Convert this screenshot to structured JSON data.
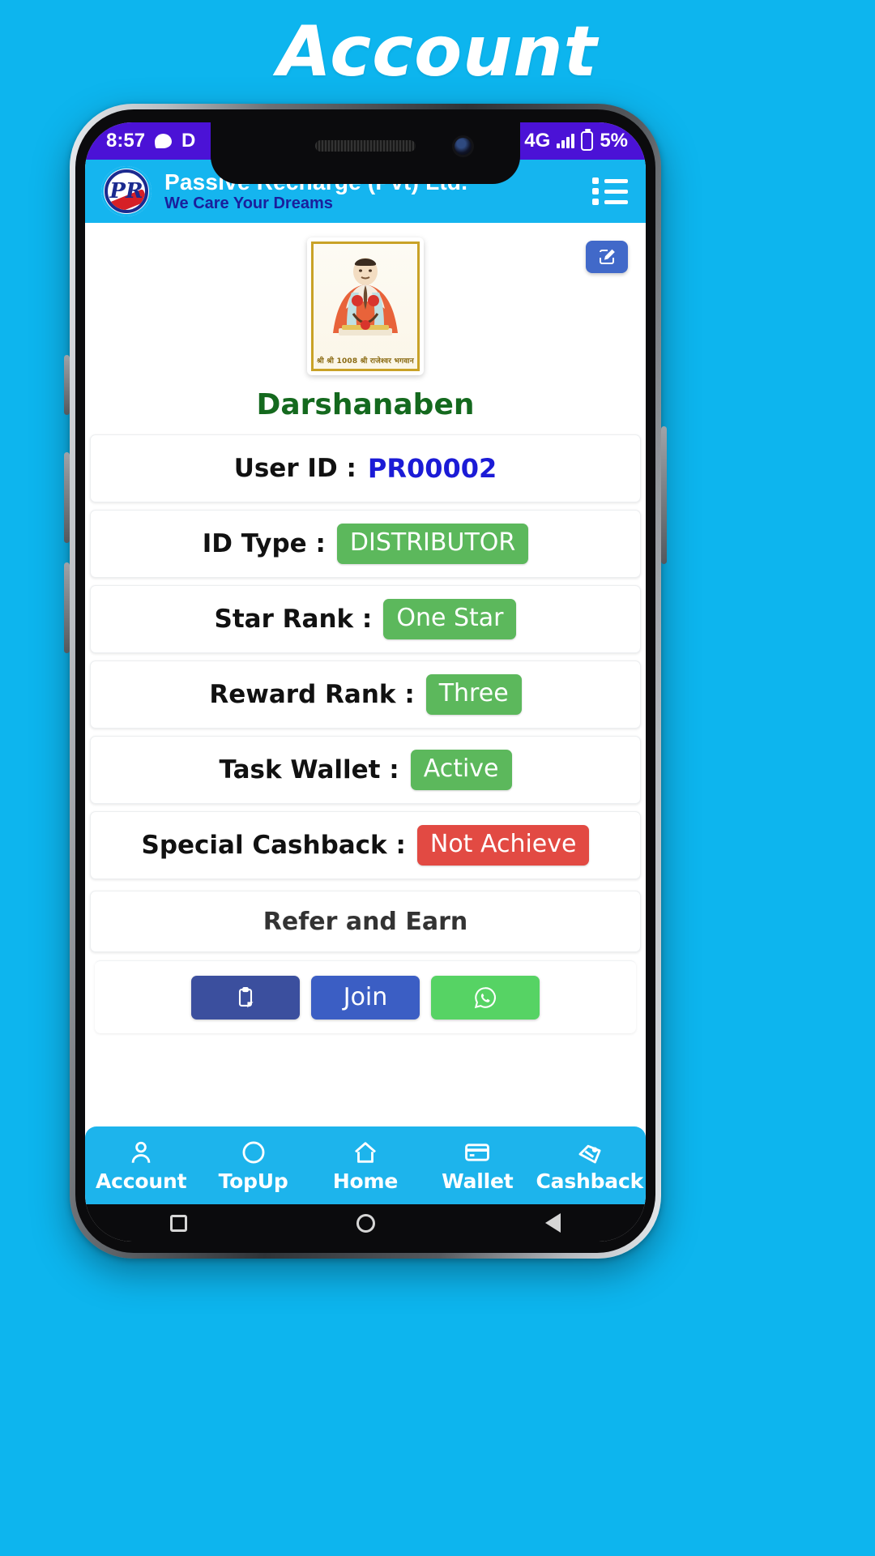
{
  "page": {
    "title": "Account",
    "background_color": "#0db5ee"
  },
  "status_bar": {
    "time": "8:57",
    "chat_icon": "chat-bubble-icon",
    "extra_glyph": "D",
    "network": "4G",
    "signal_icon": "signal-bars-icon",
    "battery_icon": "battery-icon",
    "battery_percent": "5%"
  },
  "app_header": {
    "logo": "passive-recharge-logo",
    "logo_text": "PR",
    "brand_name": "Passive Recharge (Pvt) Ltd.",
    "tagline": "We Care Your Dreams",
    "menu_icon": "list-menu-icon",
    "background_color": "#15b5ef"
  },
  "profile": {
    "edit_icon": "edit-square-icon",
    "avatar_caption": "श्री श्री 1008 श्री राजेश्वर भगवान",
    "name": "Darshanaben",
    "name_color": "#14691e"
  },
  "details": [
    {
      "label": "User ID :",
      "value": "PR00002",
      "style": "plain",
      "color": "#1b1bd6"
    },
    {
      "label": "ID Type :",
      "value": "DISTRIBUTOR",
      "style": "badge",
      "color": "#5cb85c"
    },
    {
      "label": "Star Rank :",
      "value": "One Star",
      "style": "badge",
      "color": "#5cb85c"
    },
    {
      "label": "Reward Rank :",
      "value": "Three",
      "style": "badge",
      "color": "#5cb85c"
    },
    {
      "label": "Task Wallet :",
      "value": "Active",
      "style": "badge",
      "color": "#5cb85c"
    },
    {
      "label": "Special Cashback :",
      "value": "Not Achieve",
      "style": "badge",
      "color": "#e24a43"
    }
  ],
  "refer": {
    "title": "Refer and Earn",
    "buttons": [
      {
        "name": "copy-button",
        "label": "",
        "icon": "clipboard-icon",
        "color": "#3b4f9e"
      },
      {
        "name": "join-button",
        "label": "Join",
        "icon": "",
        "color": "#3b5ec4"
      },
      {
        "name": "whatsapp-button",
        "label": "",
        "icon": "whatsapp-icon",
        "color": "#56d364"
      }
    ]
  },
  "bottom_nav": {
    "items": [
      {
        "label": "Account",
        "icon": "person-icon"
      },
      {
        "label": "TopUp",
        "icon": "circle-icon"
      },
      {
        "label": "Home",
        "icon": "home-icon"
      },
      {
        "label": "Wallet",
        "icon": "card-icon"
      },
      {
        "label": "Cashback",
        "icon": "tag-icon"
      }
    ],
    "background_color": "#1db4ec"
  },
  "android_nav": {
    "recent_icon": "square-icon",
    "home_icon": "circle-icon",
    "back_icon": "triangle-back-icon"
  }
}
